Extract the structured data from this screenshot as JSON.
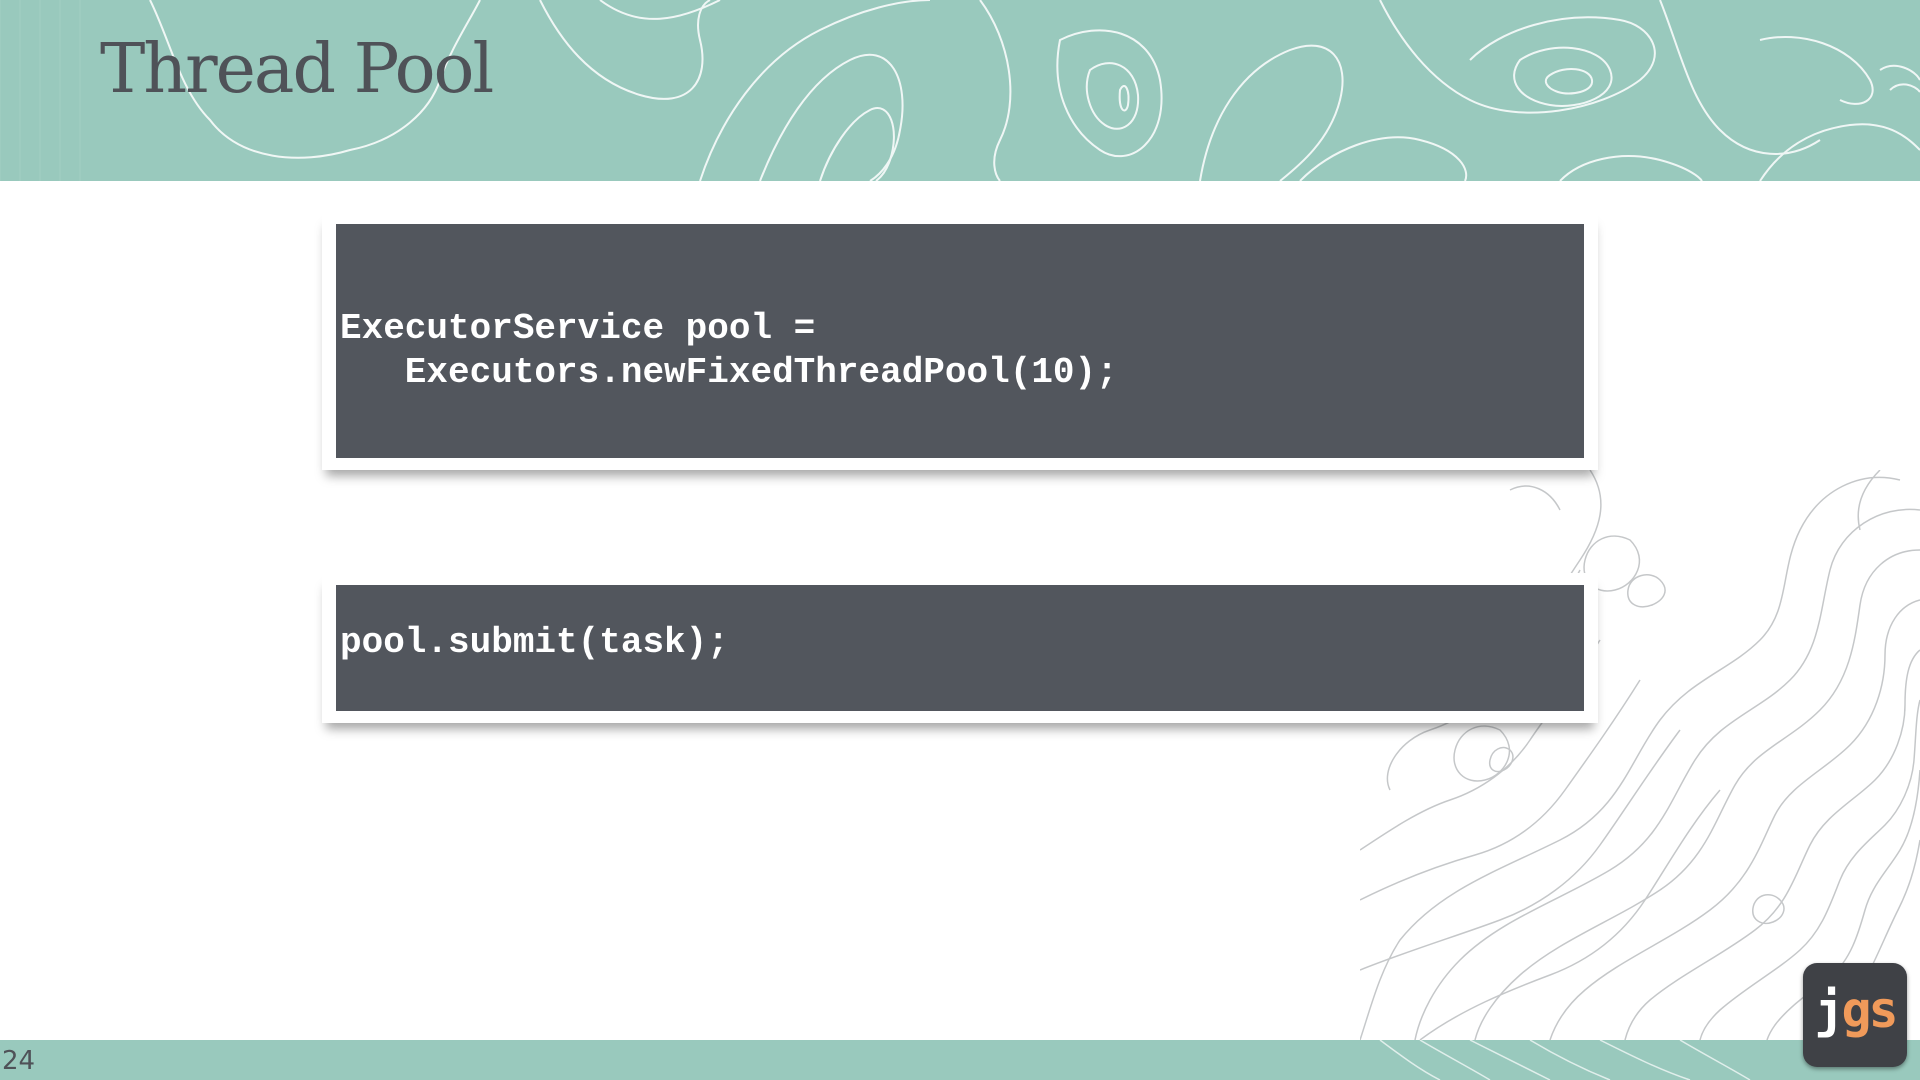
{
  "slide": {
    "title": "Thread Pool",
    "page_number": "24"
  },
  "code_blocks": [
    {
      "lines": [
        "ExecutorService pool =",
        "   Executors.newFixedThreadPool(10);"
      ]
    },
    {
      "lines": [
        "pool.submit(task);"
      ]
    }
  ],
  "logo": {
    "letter_j": "j",
    "letters_gs": "gs",
    "colors": {
      "j": "#ffffff",
      "gs": "#f09a5a",
      "badge": "#3f4146"
    }
  },
  "theme": {
    "band_color": "#99c9bd",
    "code_background": "#52565d",
    "title_color": "#4f5258"
  }
}
